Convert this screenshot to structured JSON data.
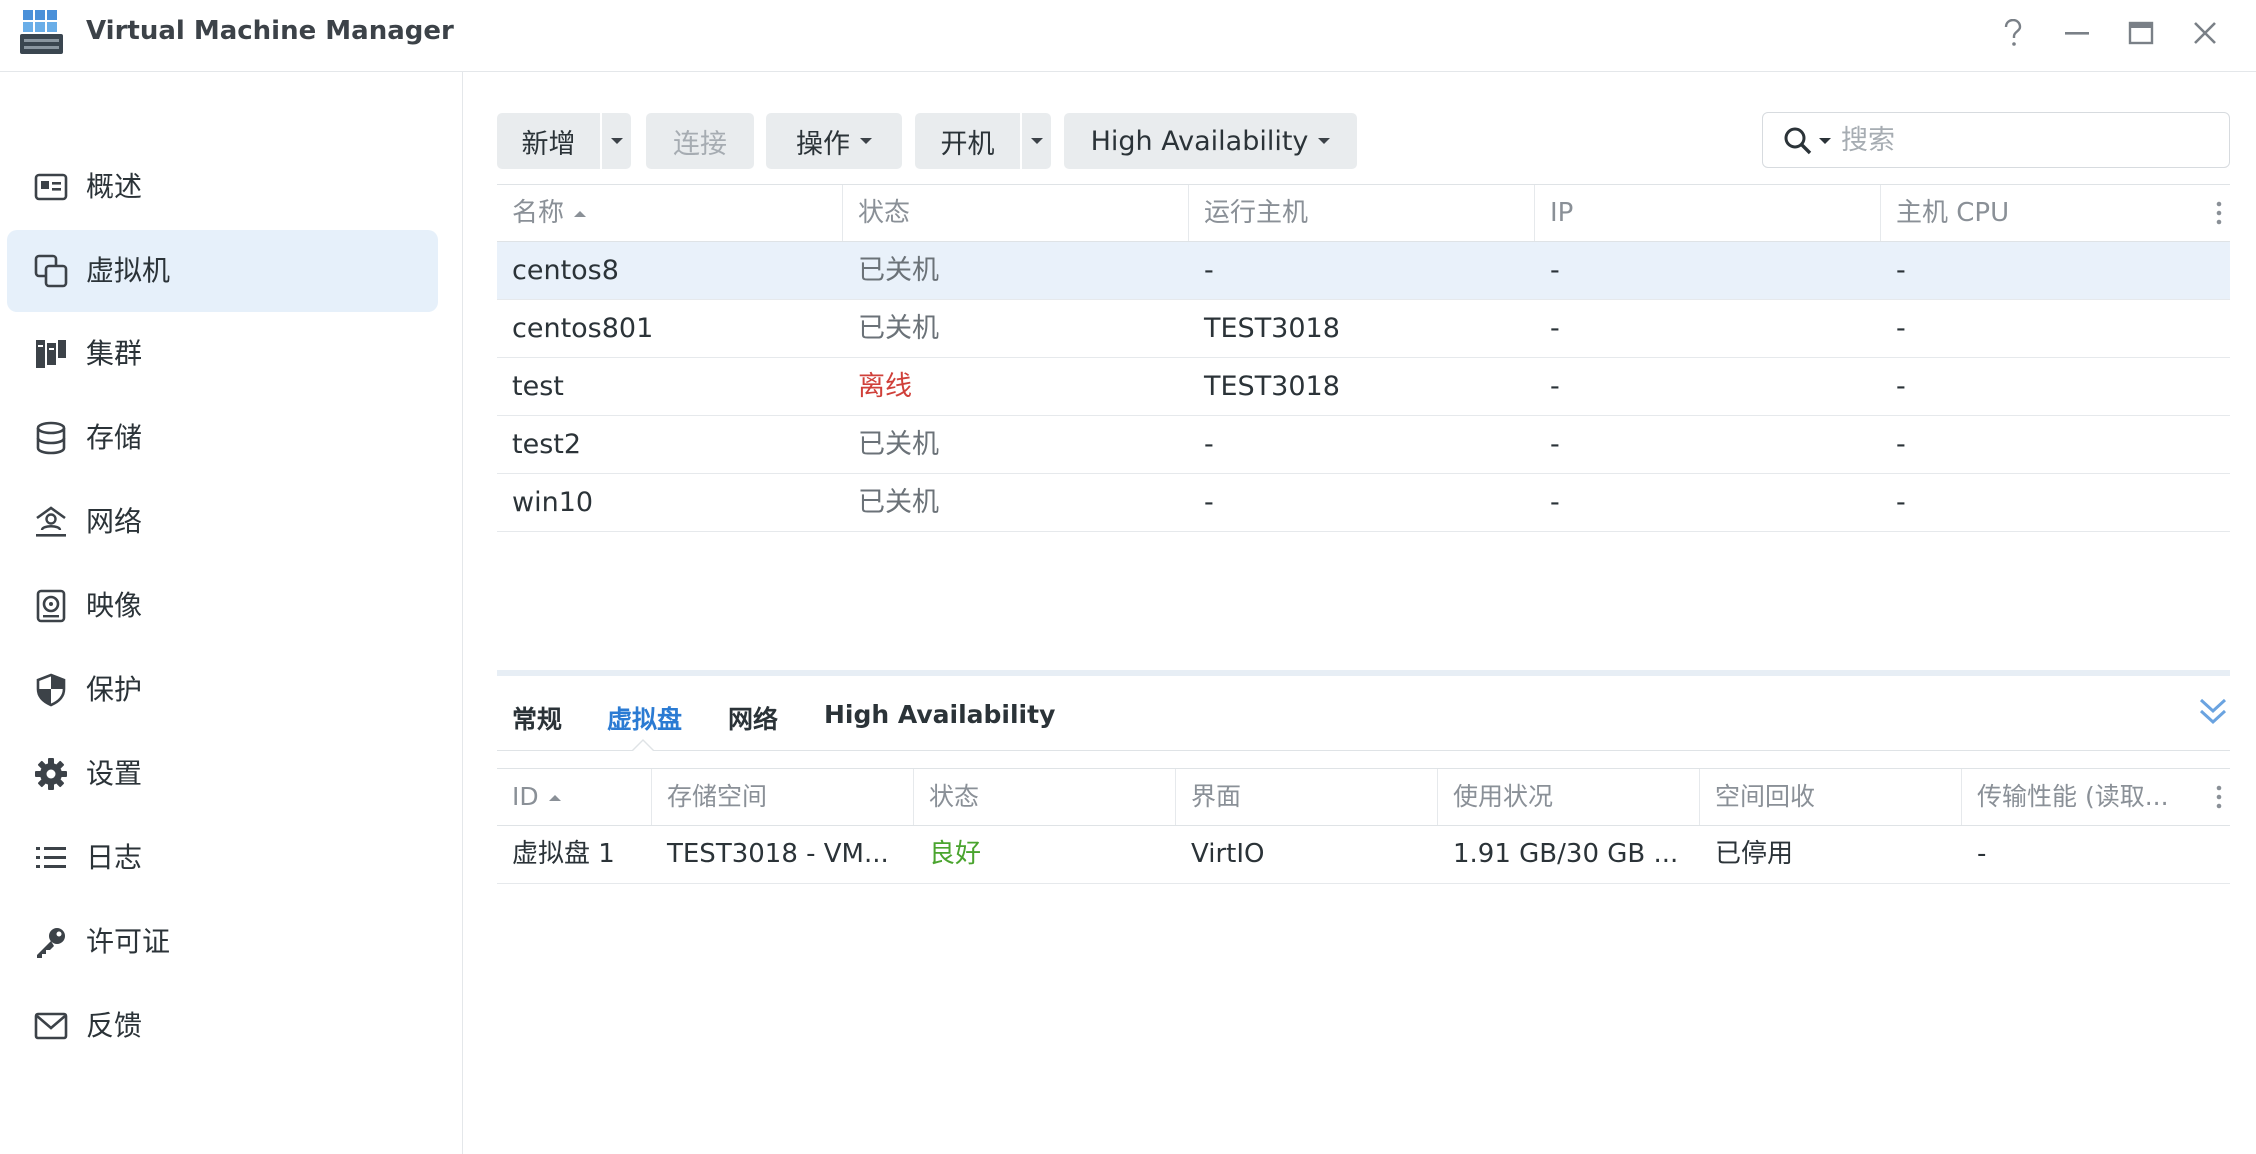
{
  "window": {
    "title": "Virtual Machine Manager",
    "controls": [
      "help-icon",
      "minimize-icon",
      "maximize-icon",
      "close-icon"
    ]
  },
  "sidebar": {
    "items": [
      {
        "label": "概述",
        "icon": "overview-icon",
        "active": false
      },
      {
        "label": "虚拟机",
        "icon": "virtual-machine-icon",
        "active": true
      },
      {
        "label": "集群",
        "icon": "cluster-icon",
        "active": false
      },
      {
        "label": "存储",
        "icon": "storage-icon",
        "active": false
      },
      {
        "label": "网络",
        "icon": "network-icon",
        "active": false
      },
      {
        "label": "映像",
        "icon": "image-icon",
        "active": false
      },
      {
        "label": "保护",
        "icon": "shield-icon",
        "active": false
      },
      {
        "label": "设置",
        "icon": "gear-icon",
        "active": false
      },
      {
        "label": "日志",
        "icon": "list-icon",
        "active": false
      },
      {
        "label": "许可证",
        "icon": "key-icon",
        "active": false
      },
      {
        "label": "反馈",
        "icon": "mail-icon",
        "active": false
      }
    ]
  },
  "toolbar": {
    "add_label": "新增",
    "connect_label": "连接",
    "action_label": "操作",
    "power_on_label": "开机",
    "ha_label": "High Availability"
  },
  "search": {
    "placeholder": "搜索",
    "value": ""
  },
  "vm_table": {
    "columns": [
      "名称",
      "状态",
      "运行主机",
      "IP",
      "主机 CPU"
    ],
    "sorted_column": "名称",
    "rows": [
      {
        "name": "centos8",
        "status": "已关机",
        "host": "-",
        "ip": "-",
        "cpu": "-",
        "selected": true
      },
      {
        "name": "centos801",
        "status": "已关机",
        "host": "TEST3018",
        "ip": "-",
        "cpu": "-",
        "selected": false
      },
      {
        "name": "test",
        "status": "离线",
        "host": "TEST3018",
        "ip": "-",
        "cpu": "-",
        "selected": false
      },
      {
        "name": "test2",
        "status": "已关机",
        "host": "-",
        "ip": "-",
        "cpu": "-",
        "selected": false
      },
      {
        "name": "win10",
        "status": "已关机",
        "host": "-",
        "ip": "-",
        "cpu": "-",
        "selected": false
      }
    ]
  },
  "detail": {
    "tabs": [
      "常规",
      "虚拟盘",
      "网络",
      "High Availability"
    ],
    "active_tab": "虚拟盘",
    "disk_table": {
      "columns": [
        "ID",
        "存储空间",
        "状态",
        "界面",
        "使用状况",
        "空间回收",
        "传输性能 (读取..."
      ],
      "sorted_column": "ID",
      "rows": [
        {
          "id": "虚拟盘 1",
          "storage": "TEST3018 - VM...",
          "status": "良好",
          "interface": "VirtIO",
          "usage": "1.91 GB/30 GB ...",
          "reclaim": "已停用",
          "transfer": "-"
        }
      ]
    }
  },
  "colors": {
    "accent": "#2b7bd3",
    "selected_row": "#e9f1fa",
    "sidebar_active": "#e6f0fa",
    "status_offline": "#d0403a",
    "status_good": "#4aa42e"
  }
}
